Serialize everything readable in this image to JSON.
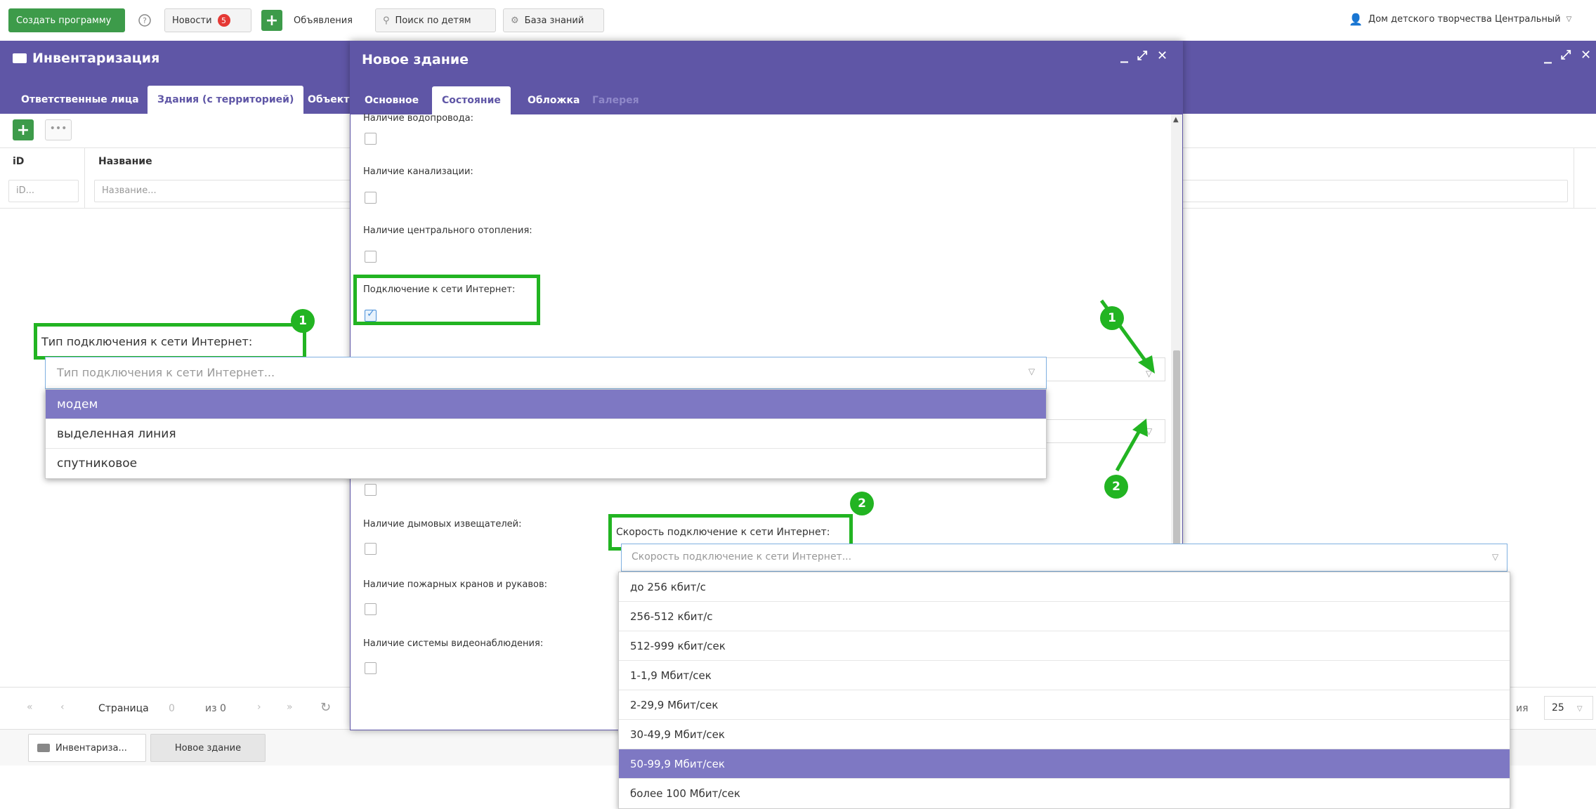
{
  "toolbar": {
    "create_program": "Создать программу",
    "news": "Новости",
    "news_count": "5",
    "announcements": "Объявления",
    "child_search": "Поиск по детям",
    "knowledge_base": "База знаний",
    "organization": "Дом детского творчества Центральный"
  },
  "main": {
    "title": "Инвентаризация",
    "tabs": [
      "Ответственные лица",
      "Здания (с территорией)",
      "Объект"
    ],
    "active_tab": 1,
    "columns": {
      "id": "iD",
      "name": "Название"
    },
    "filters": {
      "id_placeholder": "iD...",
      "name_placeholder": "Название..."
    },
    "pager": {
      "page_label": "Страница",
      "page_value": "0",
      "of_label": "из 0",
      "size_label": "ия",
      "size_value": "25"
    }
  },
  "dialog": {
    "title": "Новое здание",
    "tabs": [
      "Основное",
      "Состояние",
      "Обложка",
      "Галерея"
    ],
    "active_tab": 1,
    "fields": [
      {
        "label": "Наличие водопровода:",
        "checked": false
      },
      {
        "label": "Наличие канализации:",
        "checked": false
      },
      {
        "label": "Наличие центрального отопления:",
        "checked": false
      },
      {
        "label": "Подключение к сети Интернет:",
        "checked": true
      },
      {
        "label": "Наличие дымовых извещателей:",
        "checked": false
      },
      {
        "label": "Наличие пожарных кранов и рукавов:",
        "checked": false
      },
      {
        "label": "Наличие системы видеонаблюдения:",
        "checked": false
      }
    ]
  },
  "dropdown1": {
    "badge": "1",
    "label": "Тип подключения к сети Интернет:",
    "placeholder": "Тип подключения к сети Интернет...",
    "options": [
      "модем",
      "выделенная линия",
      "спутниковое"
    ],
    "selected": 0
  },
  "dropdown2": {
    "badge": "2",
    "label": "Скорость подключение к сети Интернет:",
    "placeholder": "Скорость  подключение к сети Интернет...",
    "options": [
      "до 256 кбит/с",
      "256-512 кбит/с",
      "512-999 кбит/сек",
      "1-1,9 Мбит/сек",
      "2-29,9 Мбит/сек",
      "30-49,9 Мбит/сек",
      "50-99,9 Мбит/сек",
      "более 100 Мбит/сек"
    ],
    "selected": 6
  },
  "taskbar": {
    "items": [
      "Инвентариза...",
      "Новое здание"
    ],
    "active": 1
  },
  "colors": {
    "header": "#5f56a6",
    "highlight": "#22b422",
    "selected_option": "#7e78c3",
    "green_button": "#3d9b4a"
  }
}
